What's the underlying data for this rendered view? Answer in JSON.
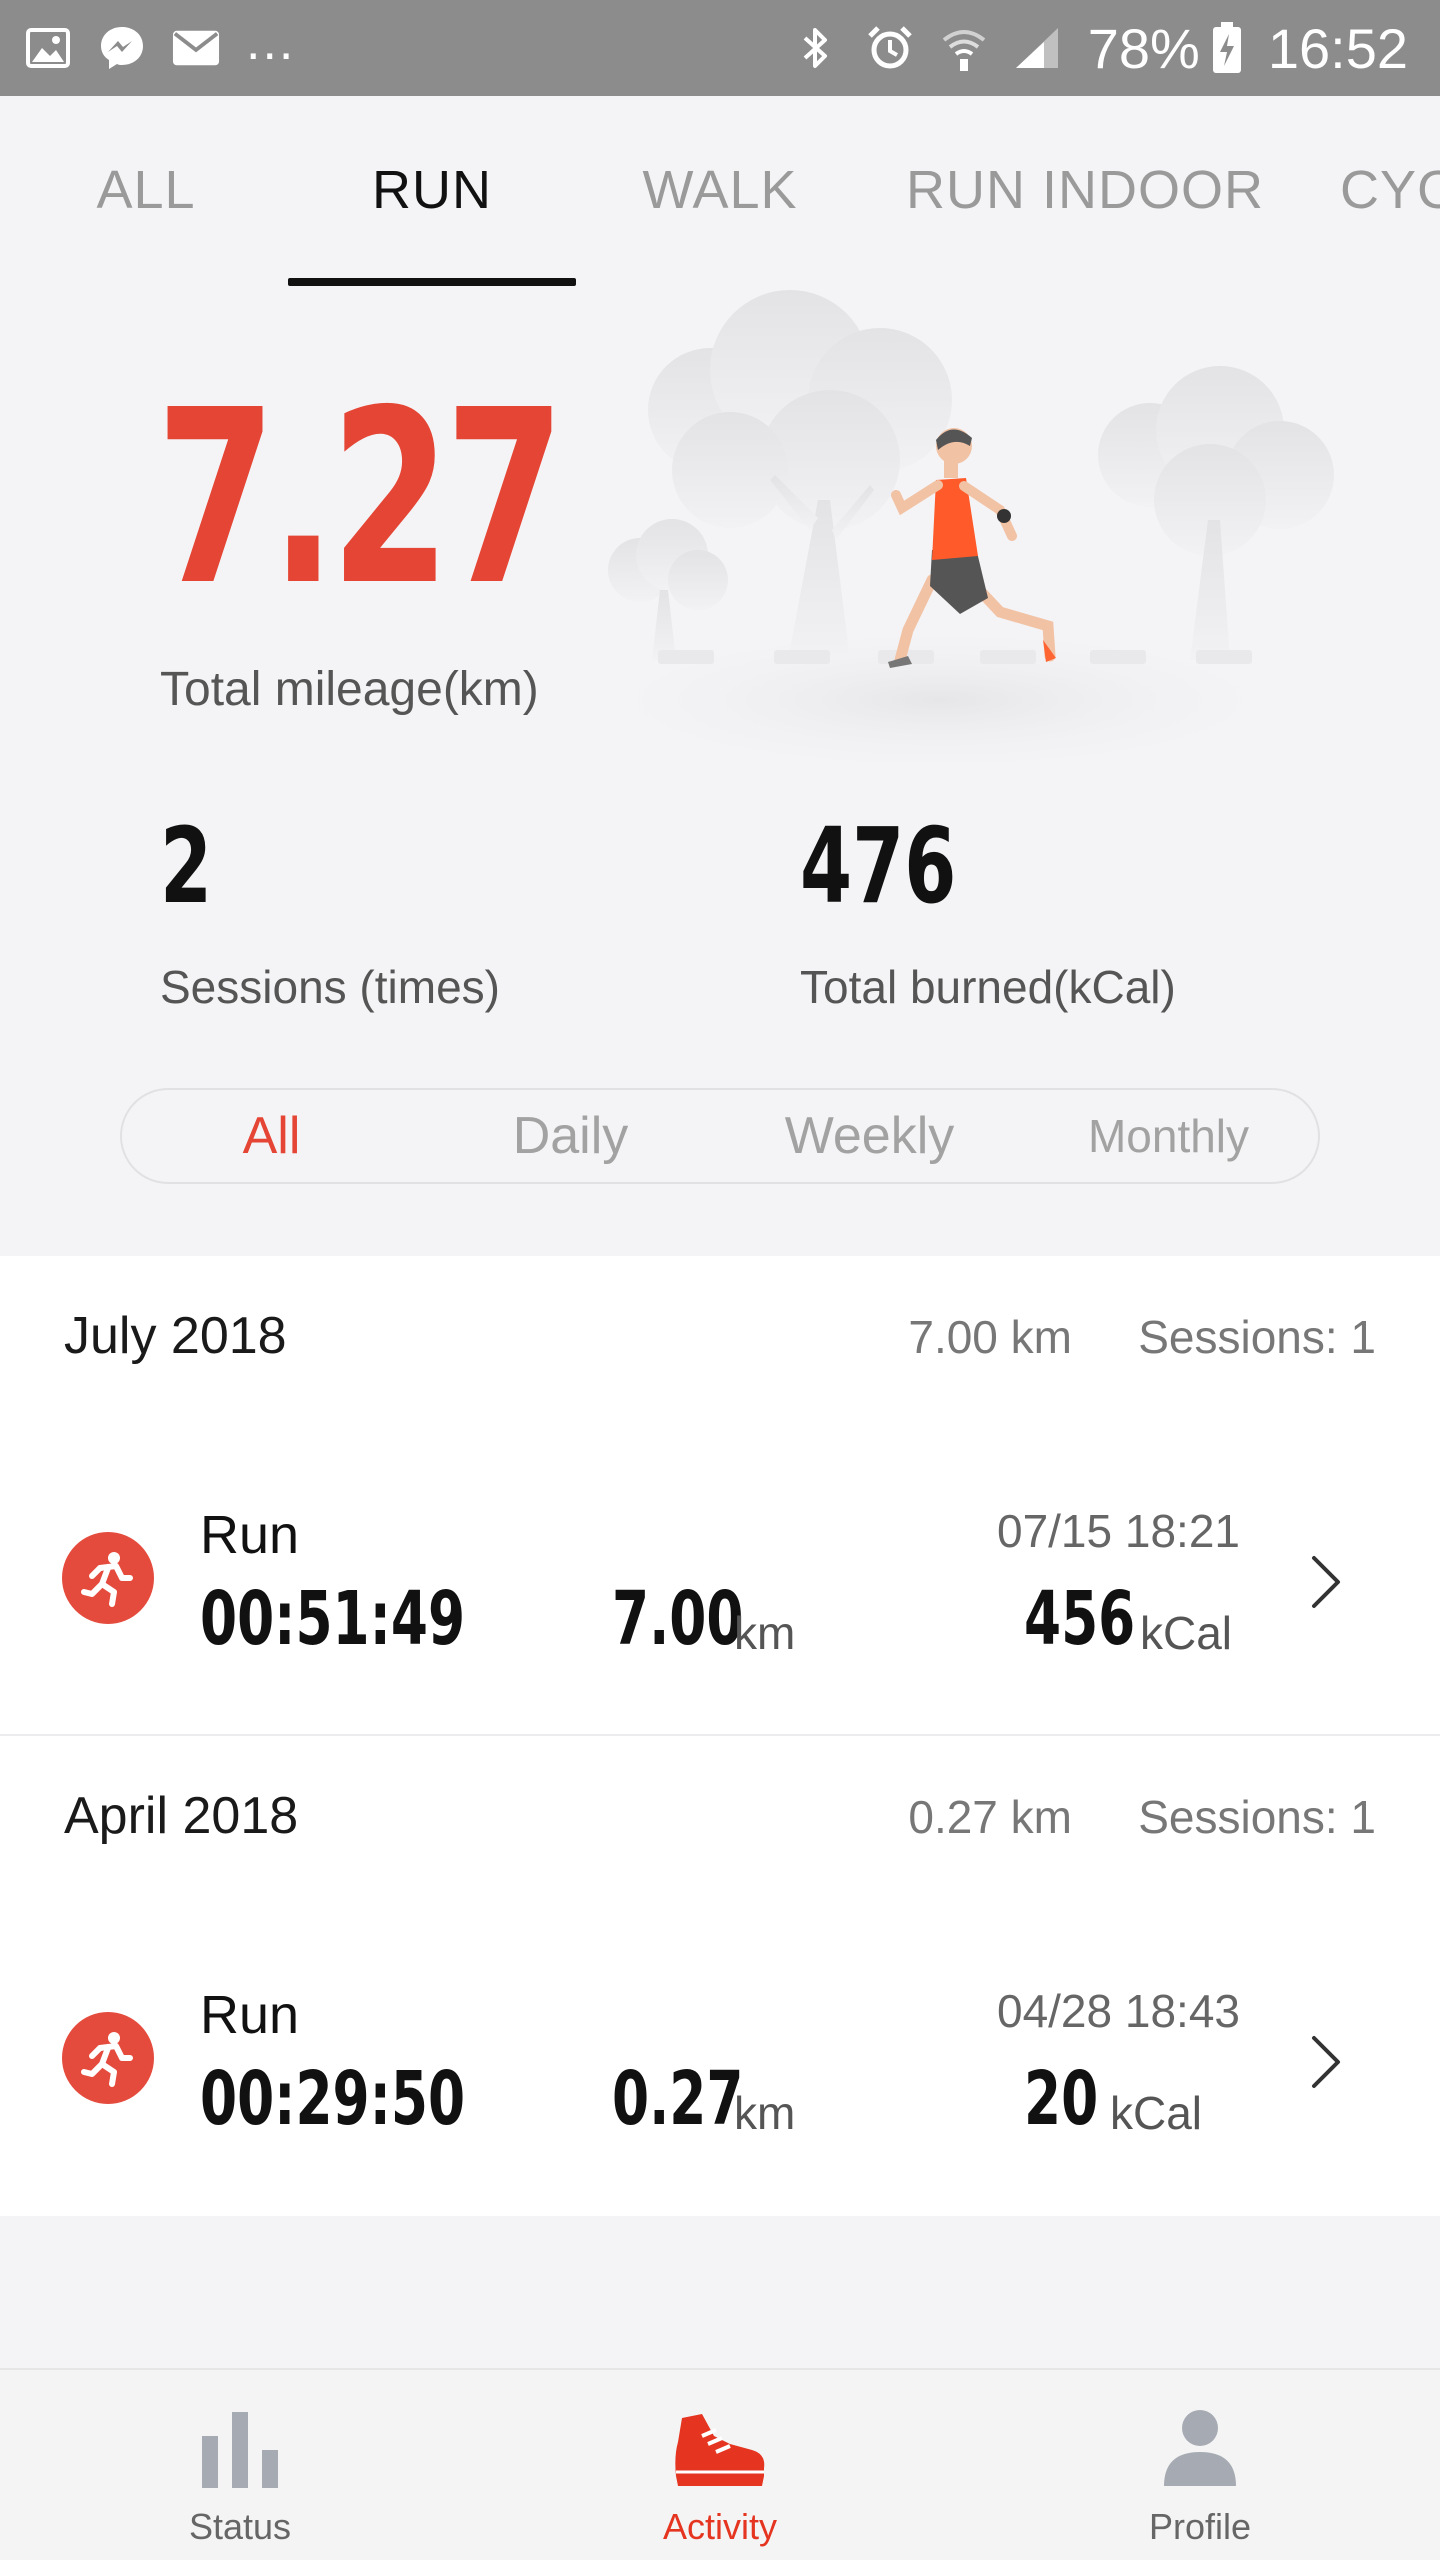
{
  "status_bar": {
    "battery": "78%",
    "time": "16:52",
    "more": "..."
  },
  "tabs": [
    {
      "label": "ALL",
      "active": false
    },
    {
      "label": "RUN",
      "active": true
    },
    {
      "label": "WALK",
      "active": false
    },
    {
      "label": "RUN INDOOR",
      "active": false
    },
    {
      "label": "CYC",
      "active": false
    }
  ],
  "summary": {
    "total_mileage_value": "7.27",
    "total_mileage_label": "Total mileage(km)",
    "sessions_value": "2",
    "sessions_label": "Sessions (times)",
    "burned_value": "476",
    "burned_label": "Total burned(kCal)"
  },
  "filter": {
    "options": [
      "All",
      "Daily",
      "Weekly",
      "Monthly"
    ],
    "selected": "All"
  },
  "months": [
    {
      "title": "July 2018",
      "km": "7.00 km",
      "sessions": "Sessions: 1",
      "entries": [
        {
          "type": "Run",
          "datetime": "07/15  18:21",
          "duration": "00:51:49",
          "distance": "7.00",
          "distance_unit": "km",
          "calories": "456",
          "calories_unit": "kCal"
        }
      ]
    },
    {
      "title": "April 2018",
      "km": "0.27 km",
      "sessions": "Sessions: 1",
      "entries": [
        {
          "type": "Run",
          "datetime": "04/28  18:43",
          "duration": "00:29:50",
          "distance": "0.27",
          "distance_unit": "km",
          "calories": "20",
          "calories_unit": "kCal"
        }
      ]
    }
  ],
  "bottom_nav": [
    {
      "label": "Status",
      "icon": "bar-chart-icon",
      "active": false
    },
    {
      "label": "Activity",
      "icon": "shoe-icon",
      "active": true
    },
    {
      "label": "Profile",
      "icon": "person-icon",
      "active": false
    }
  ],
  "colors": {
    "accent": "#e54534",
    "status_bar": "#8c8c8c",
    "background": "#f4f4f6"
  }
}
